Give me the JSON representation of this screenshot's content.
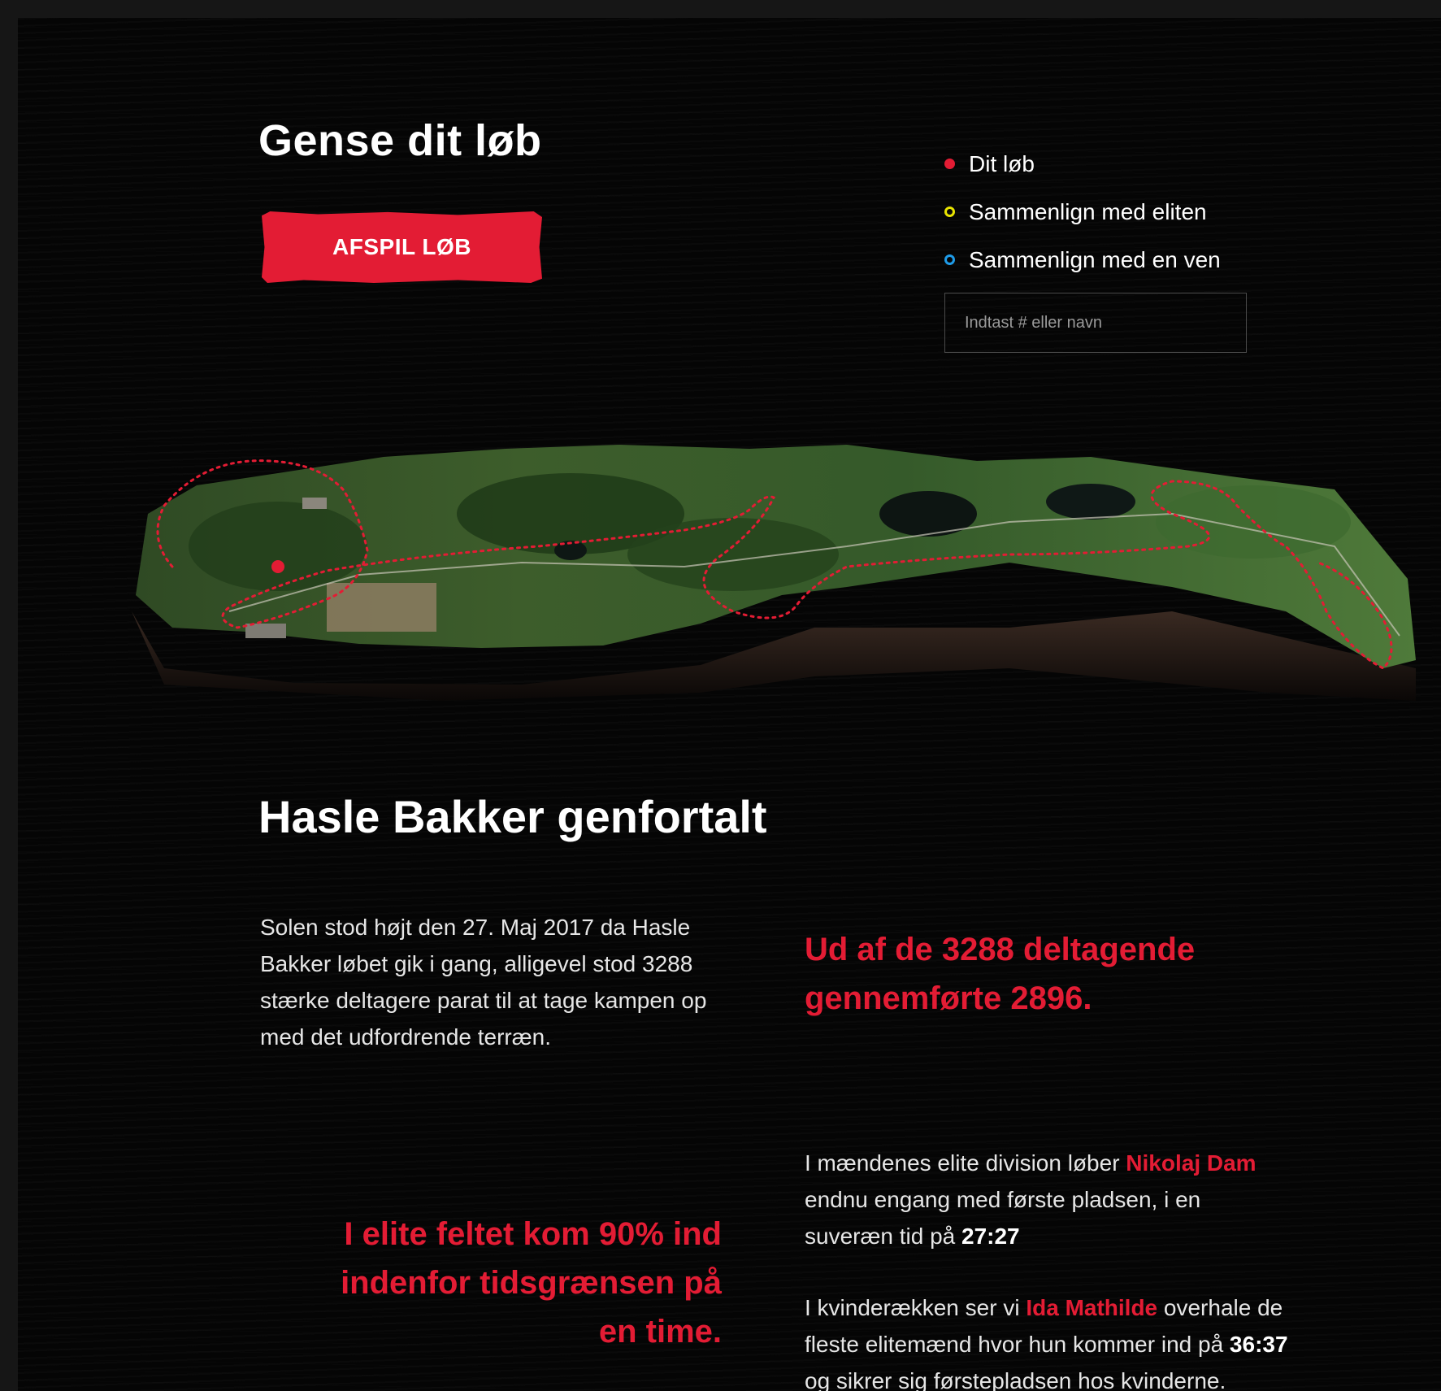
{
  "hero": {
    "title": "Gense dit løb",
    "play_button_label": "AFSPIL LØB"
  },
  "legend": {
    "items": [
      {
        "label": "Dit løb",
        "color": "#e31c34",
        "style": "filled"
      },
      {
        "label": "Sammenlign med eliten",
        "color": "#e8e400",
        "style": "ring"
      },
      {
        "label": "Sammenlign med en ven",
        "color": "#1e9be8",
        "style": "ring"
      }
    ],
    "search_placeholder": "Indtast # eller navn"
  },
  "map": {
    "route_color": "#e31c34",
    "runner_color": "#e31c34"
  },
  "story": {
    "title": "Hasle Bakker genfortalt",
    "intro": "Solen stod højt den 27. Maj 2017 da Hasle Bakker løbet gik i gang, alligevel stod 3288 stærke deltagere parat til at tage kampen op med det udfordrende terræn.",
    "stat_finishers": "Ud af de 3288 deltagende gennemførte 2896.",
    "stat_elite": "I elite feltet kom 90% ind indenfor tidsgrænsen på en time.",
    "men": {
      "before": "I mændenes elite division løber ",
      "name": "Nikolaj Dam",
      "middle": " endnu engang med første pladsen, i en suveræn tid på ",
      "time": "27:27"
    },
    "women": {
      "before": "I kvinderækken ser vi ",
      "name": "Ida Mathilde",
      "middle": " overhale de fleste elitemænd hvor hun kommer ind på ",
      "time": "36:37",
      "after": " og sikrer sig førstepladsen hos kvinderne."
    }
  },
  "colors": {
    "accent": "#e31c34",
    "background": "#050505",
    "text": "#ffffff"
  }
}
